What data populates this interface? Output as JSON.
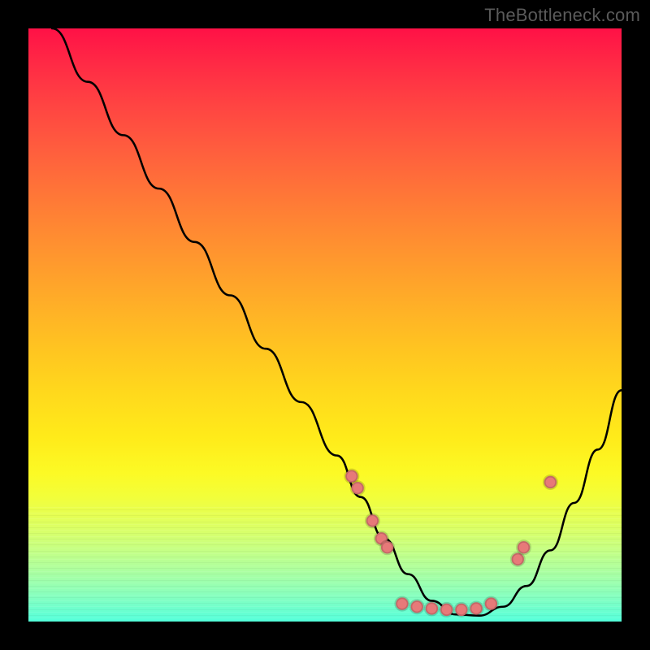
{
  "watermark": "TheBottleneck.com",
  "chart_data": {
    "type": "line",
    "title": "",
    "xlabel": "",
    "ylabel": "",
    "xlim": [
      0,
      100
    ],
    "ylim": [
      0,
      100
    ],
    "grid": false,
    "legend": false,
    "series": [
      {
        "name": "curve",
        "x": [
          4,
          10,
          16,
          22,
          28,
          34,
          40,
          46,
          52,
          56,
          60,
          64,
          68,
          72,
          76,
          80,
          84,
          88,
          92,
          96,
          100
        ],
        "y": [
          100,
          91,
          82,
          73,
          64,
          55,
          46,
          37,
          28,
          21,
          14,
          8,
          3.5,
          1.2,
          1.0,
          2.5,
          6,
          12,
          20,
          29,
          39
        ]
      }
    ],
    "markers": [
      {
        "x": 54.5,
        "y": 24.5
      },
      {
        "x": 55.5,
        "y": 22.5
      },
      {
        "x": 58.0,
        "y": 17.0
      },
      {
        "x": 59.5,
        "y": 14.0
      },
      {
        "x": 60.5,
        "y": 12.5
      },
      {
        "x": 63.0,
        "y": 3.0
      },
      {
        "x": 65.5,
        "y": 2.5
      },
      {
        "x": 68.0,
        "y": 2.2
      },
      {
        "x": 70.5,
        "y": 2.0
      },
      {
        "x": 73.0,
        "y": 2.0
      },
      {
        "x": 75.5,
        "y": 2.2
      },
      {
        "x": 78.0,
        "y": 3.0
      },
      {
        "x": 82.5,
        "y": 10.5
      },
      {
        "x": 83.5,
        "y": 12.5
      },
      {
        "x": 88.0,
        "y": 23.5
      }
    ],
    "background_gradient": {
      "top": "#ff1146",
      "mid_upper": "#ff8932",
      "mid": "#ffda1c",
      "mid_lower": "#d7ff6c",
      "bottom": "#54ffdb"
    }
  }
}
